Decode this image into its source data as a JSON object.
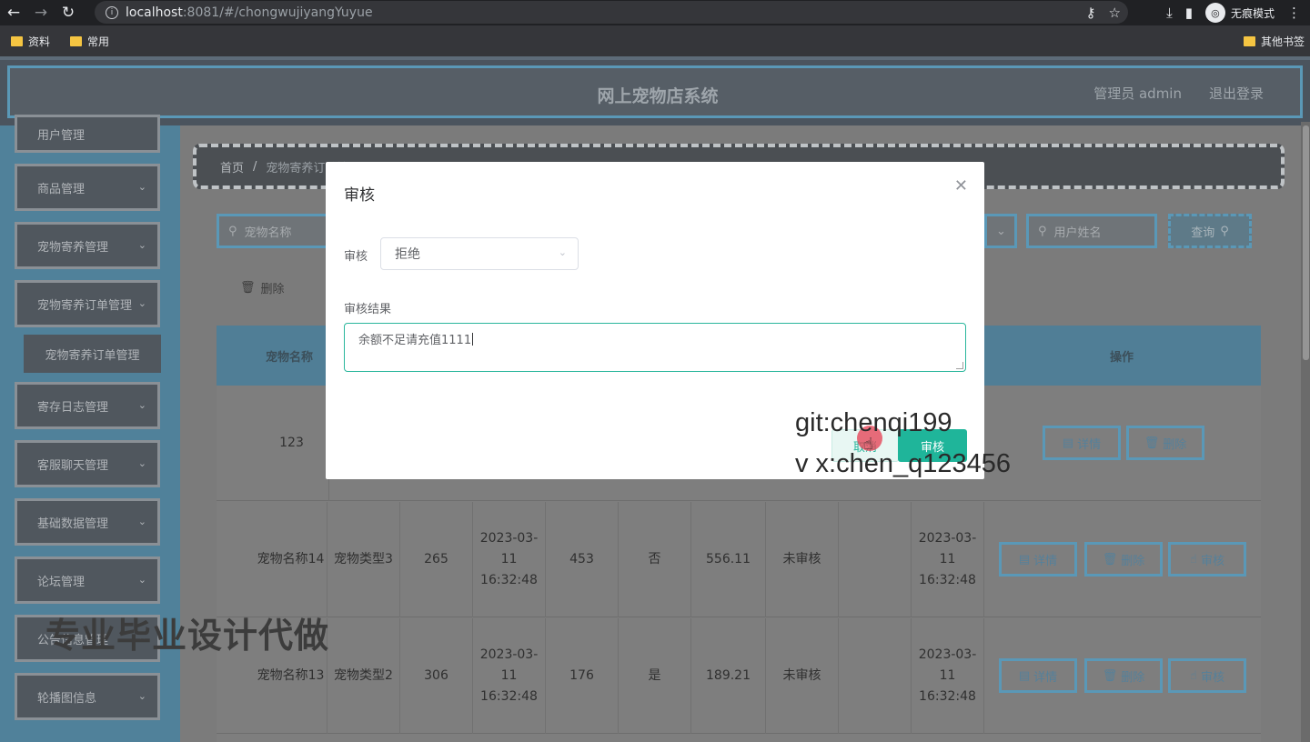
{
  "browser": {
    "url_host": "localhost",
    "url_path": ":8081/#/chongwujiyangYuyue",
    "incognito_label": "无痕模式",
    "bookmarks": [
      "资料",
      "常用"
    ],
    "bookmarks_right": "其他书签"
  },
  "header": {
    "title": "网上宠物店系统",
    "user": "管理员 admin",
    "logout": "退出登录"
  },
  "sidebar": {
    "items": [
      "用户管理",
      "商品管理",
      "宠物寄养管理",
      "宠物寄养订单管理",
      "寄存日志管理",
      "客服聊天管理",
      "基础数据管理",
      "论坛管理",
      "公告信息管理",
      "轮播图信息"
    ],
    "submenu": "宠物寄养订单管理"
  },
  "breadcrumb": {
    "home": "首页",
    "separator": "/",
    "current": "宠物寄养订单管理"
  },
  "search": {
    "pet_name_placeholder": "宠物名称",
    "user_name_placeholder": "用户姓名",
    "query_label": "查询"
  },
  "toolbar": {
    "delete_label": "删除"
  },
  "table": {
    "headers": {
      "pet_name": "宠物名称",
      "ops": "操作"
    },
    "rows": [
      {
        "pet_name": "123",
        "ops": [
          "详情",
          "删除"
        ]
      },
      {
        "pet_name": "宠物名称14",
        "pet_type": "宠物类型3",
        "c3": "265",
        "date": "2023-03-11 16:32:48",
        "c5": "453",
        "flag": "否",
        "amount": "556.11",
        "status": "未审核",
        "date2": "2023-03-11 16:32:48",
        "ops": [
          "详情",
          "删除",
          "审核"
        ]
      },
      {
        "pet_name": "宠物名称13",
        "pet_type": "宠物类型2",
        "c3": "306",
        "date": "2023-03-11 16:32:48",
        "c5": "176",
        "flag": "是",
        "amount": "189.21",
        "status": "未审核",
        "date2": "2023-03-11 16:32:48",
        "ops": [
          "详情",
          "删除",
          "审核"
        ]
      }
    ]
  },
  "modal": {
    "title": "审核",
    "review_label": "审核",
    "review_value": "拒绝",
    "result_label": "审核结果",
    "result_value": "余额不足请充值1111",
    "cancel_label": "取消",
    "submit_label": "审核"
  },
  "watermarks": {
    "git": "git:chenqi199",
    "vx": "v x:chen_q123456",
    "cn": "专业毕业设计代做"
  }
}
